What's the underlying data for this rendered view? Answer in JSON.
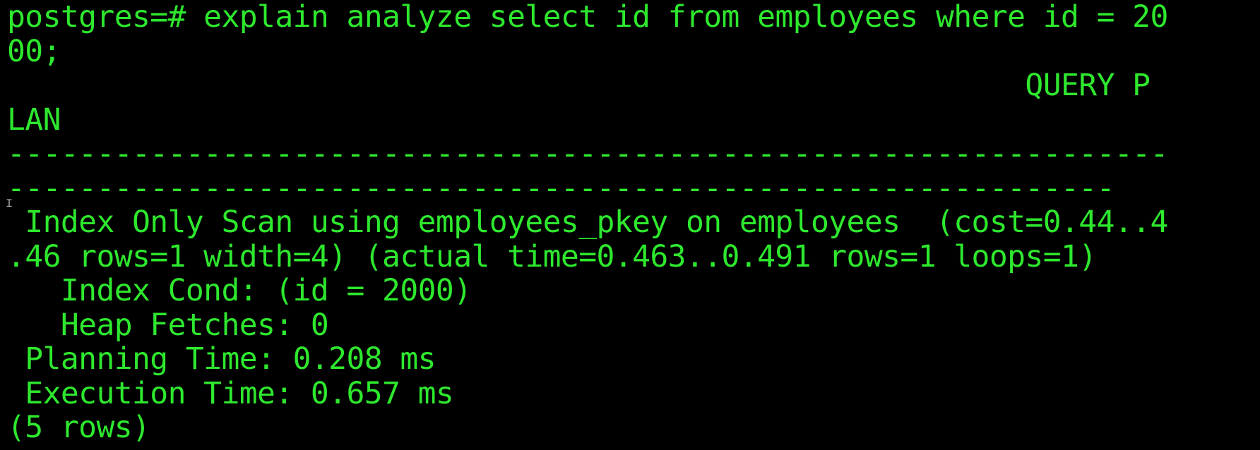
{
  "terminal": {
    "text_color": "#2ee82e",
    "background_color": "#000000",
    "lines": [
      "postgres=# explain analyze select id from employees where id = 20",
      "00;",
      "                                                         QUERY P",
      "LAN",
      "-----------------------------------------------------------------",
      "--------------------------------------------------------------",
      " Index Only Scan using employees_pkey on employees  (cost=0.44..4",
      ".46 rows=1 width=4) (actual time=0.463..0.491 rows=1 loops=1)",
      "   Index Cond: (id = 2000)",
      "   Heap Fetches: 0",
      " Planning Time: 0.208 ms",
      " Execution Time: 0.657 ms",
      "(5 rows)"
    ],
    "cursor_icon": "text-cursor-ibeam-icon"
  }
}
